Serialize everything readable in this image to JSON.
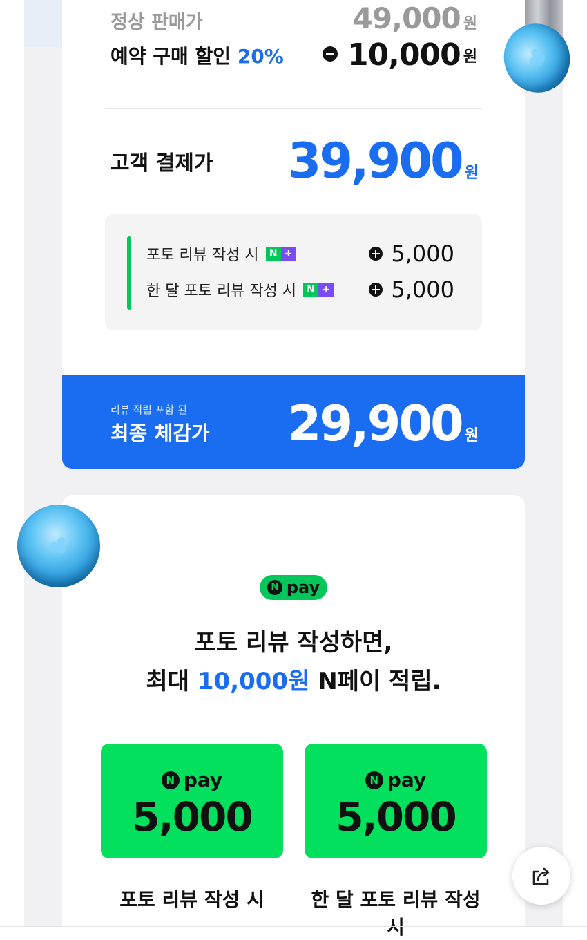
{
  "price_card": {
    "regular_label": "정상 판매가",
    "regular_amount": "49,000",
    "discount_label": "예약 구매 할인",
    "discount_percent": "20%",
    "discount_amount": "10,000",
    "customer_label": "고객 결제가",
    "customer_amount": "39,900",
    "unit": "원",
    "reviews": [
      {
        "label": "포토 리뷰 작성 시",
        "badge_n": "N",
        "badge_plus": "+",
        "amount": "5,000"
      },
      {
        "label": "한 달 포토 리뷰 작성 시",
        "badge_n": "N",
        "badge_plus": "+",
        "amount": "5,000"
      }
    ]
  },
  "final_bar": {
    "small_label": "리뷰 적립 포함 된",
    "label": "최종 체감가",
    "amount": "29,900",
    "unit": "원"
  },
  "npay_card": {
    "logo_n": "N",
    "logo_pay": "pay",
    "headline_line1": "포토 리뷰 작성하면,",
    "headline_prefix": "최대",
    "headline_highlight": "10,000원",
    "headline_suffix": "N페이 적립.",
    "coupons": [
      {
        "amount": "5,000",
        "caption": "포토 리뷰 작성 시"
      },
      {
        "amount": "5,000",
        "caption": "한 달 포토 리뷰 작성 시"
      }
    ]
  },
  "icons": {
    "share": "share-icon",
    "coin": "clover-coin-icon"
  },
  "colors": {
    "accent_blue": "#1a6cf0",
    "npay_green": "#03c75a",
    "coupon_green": "#03e05d"
  }
}
